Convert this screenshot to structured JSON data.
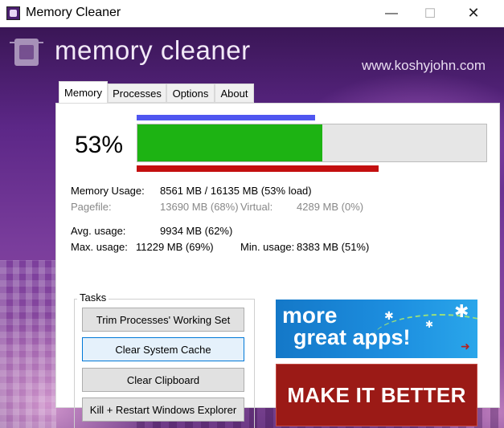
{
  "window": {
    "title": "Memory Cleaner",
    "minimize_glyph": "—",
    "maximize_glyph": "☐",
    "close_glyph": "✕"
  },
  "banner": {
    "brand": "memory cleaner",
    "site": "www.koshyjohn.com"
  },
  "tabs": [
    {
      "label": "Memory",
      "active": true
    },
    {
      "label": "Processes",
      "active": false
    },
    {
      "label": "Options",
      "active": false
    },
    {
      "label": "About",
      "active": false
    }
  ],
  "memory": {
    "percent_text": "53%",
    "load_fraction": 0.53,
    "top_bar_fraction": 0.51,
    "bottom_bar_fraction": 0.69,
    "bar_colors": {
      "fill": "#1db313",
      "top": "#4f56f0",
      "bottom": "#c30f0f"
    },
    "usage_label": "Memory Usage:",
    "usage_value": "8561 MB / 16135 MB  (53% load)",
    "pagefile_label": "Pagefile:",
    "pagefile_value": "13690 MB (68%)",
    "virtual_label": "Virtual:",
    "virtual_value": "4289 MB (0%)",
    "avg_label": "Avg. usage:",
    "avg_value": "9934 MB (62%)",
    "max_label": "Max. usage:",
    "max_value": "11229 MB (69%)",
    "min_label": "Min. usage:",
    "min_value": "8383 MB (51%)"
  },
  "tasks": {
    "group_label": "Tasks",
    "buttons": [
      "Trim Processes' Working Set",
      "Clear System Cache",
      "Clear Clipboard",
      "Kill + Restart Windows Explorer"
    ]
  },
  "ads": {
    "more_line1": "more",
    "more_line2": "great apps!",
    "make_better": "MAKE IT BETTER"
  }
}
